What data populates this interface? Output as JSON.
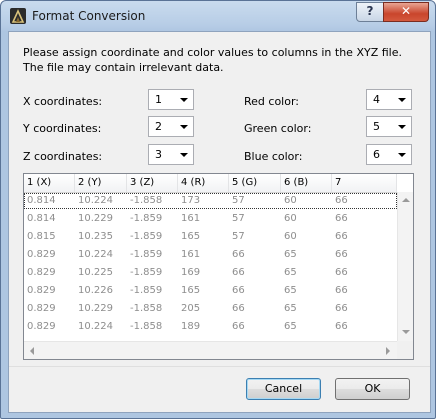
{
  "window": {
    "title": "Format Conversion"
  },
  "titlebar": {
    "help_label": "?",
    "close_label": "✕"
  },
  "intro_text": "Please assign coordinate and color values to columns in the XYZ file. The file may contain irrelevant data.",
  "fields": {
    "x": {
      "label": "X coordinates:",
      "value": "1"
    },
    "y": {
      "label": "Y coordinates:",
      "value": "2"
    },
    "z": {
      "label": "Z coordinates:",
      "value": "3"
    },
    "red": {
      "label": "Red color:",
      "value": "4"
    },
    "green": {
      "label": "Green color:",
      "value": "5"
    },
    "blue": {
      "label": "Blue color:",
      "value": "6"
    }
  },
  "table": {
    "columns": [
      "1 (X)",
      "2 (Y)",
      "3 (Z)",
      "4 (R)",
      "5 (G)",
      "6 (B)",
      "7"
    ],
    "rows": [
      [
        "0.814",
        "10.224",
        "-1.858",
        "173",
        "57",
        "60",
        "66"
      ],
      [
        "0.814",
        "10.229",
        "-1.859",
        "161",
        "57",
        "60",
        "66"
      ],
      [
        "0.815",
        "10.235",
        "-1.859",
        "165",
        "57",
        "60",
        "66"
      ],
      [
        "0.829",
        "10.224",
        "-1.859",
        "161",
        "66",
        "65",
        "66"
      ],
      [
        "0.829",
        "10.225",
        "-1.859",
        "169",
        "66",
        "65",
        "66"
      ],
      [
        "0.829",
        "10.226",
        "-1.859",
        "165",
        "66",
        "65",
        "66"
      ],
      [
        "0.829",
        "10.229",
        "-1.858",
        "205",
        "66",
        "65",
        "66"
      ],
      [
        "0.829",
        "10.224",
        "-1.858",
        "189",
        "66",
        "65",
        "66"
      ]
    ]
  },
  "buttons": {
    "cancel": "Cancel",
    "ok": "OK"
  }
}
